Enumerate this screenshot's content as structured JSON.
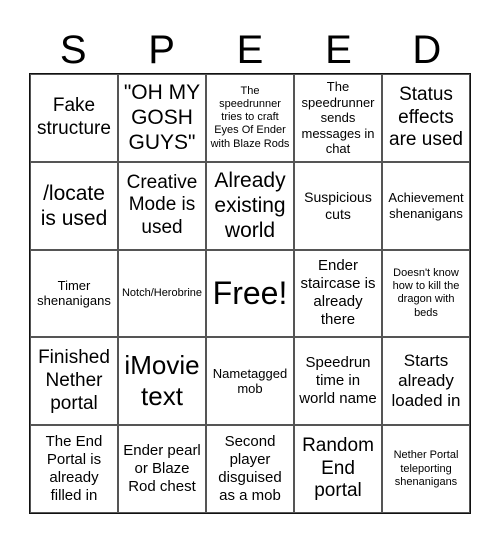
{
  "header": {
    "letters": [
      "S",
      "P",
      "E",
      "E",
      "D"
    ]
  },
  "board": {
    "cells": [
      [
        "Fake structure",
        "\"OH MY GOSH GUYS\"",
        "The speedrunner tries to craft Eyes Of Ender with Blaze Rods",
        "The speedrunner sends messages in chat",
        "Status effects are used"
      ],
      [
        "/locate is used",
        "Creative Mode is used",
        "Already existing world",
        "Suspicious cuts",
        "Achievement shenanigans"
      ],
      [
        "Timer shenanigans",
        "Notch/Herobrine",
        "Free!",
        "Ender staircase is already there",
        "Doesn't know how to kill the dragon with beds"
      ],
      [
        "Finished Nether portal",
        "iMovie text",
        "Nametagged mob",
        "Speedrun time in world name",
        "Starts already loaded in"
      ],
      [
        "The End Portal is already filled in",
        "Ender pearl or Blaze Rod chest",
        "Second player disguised as a mob",
        "Random End portal",
        "Nether Portal teleporting shenanigans"
      ]
    ]
  }
}
